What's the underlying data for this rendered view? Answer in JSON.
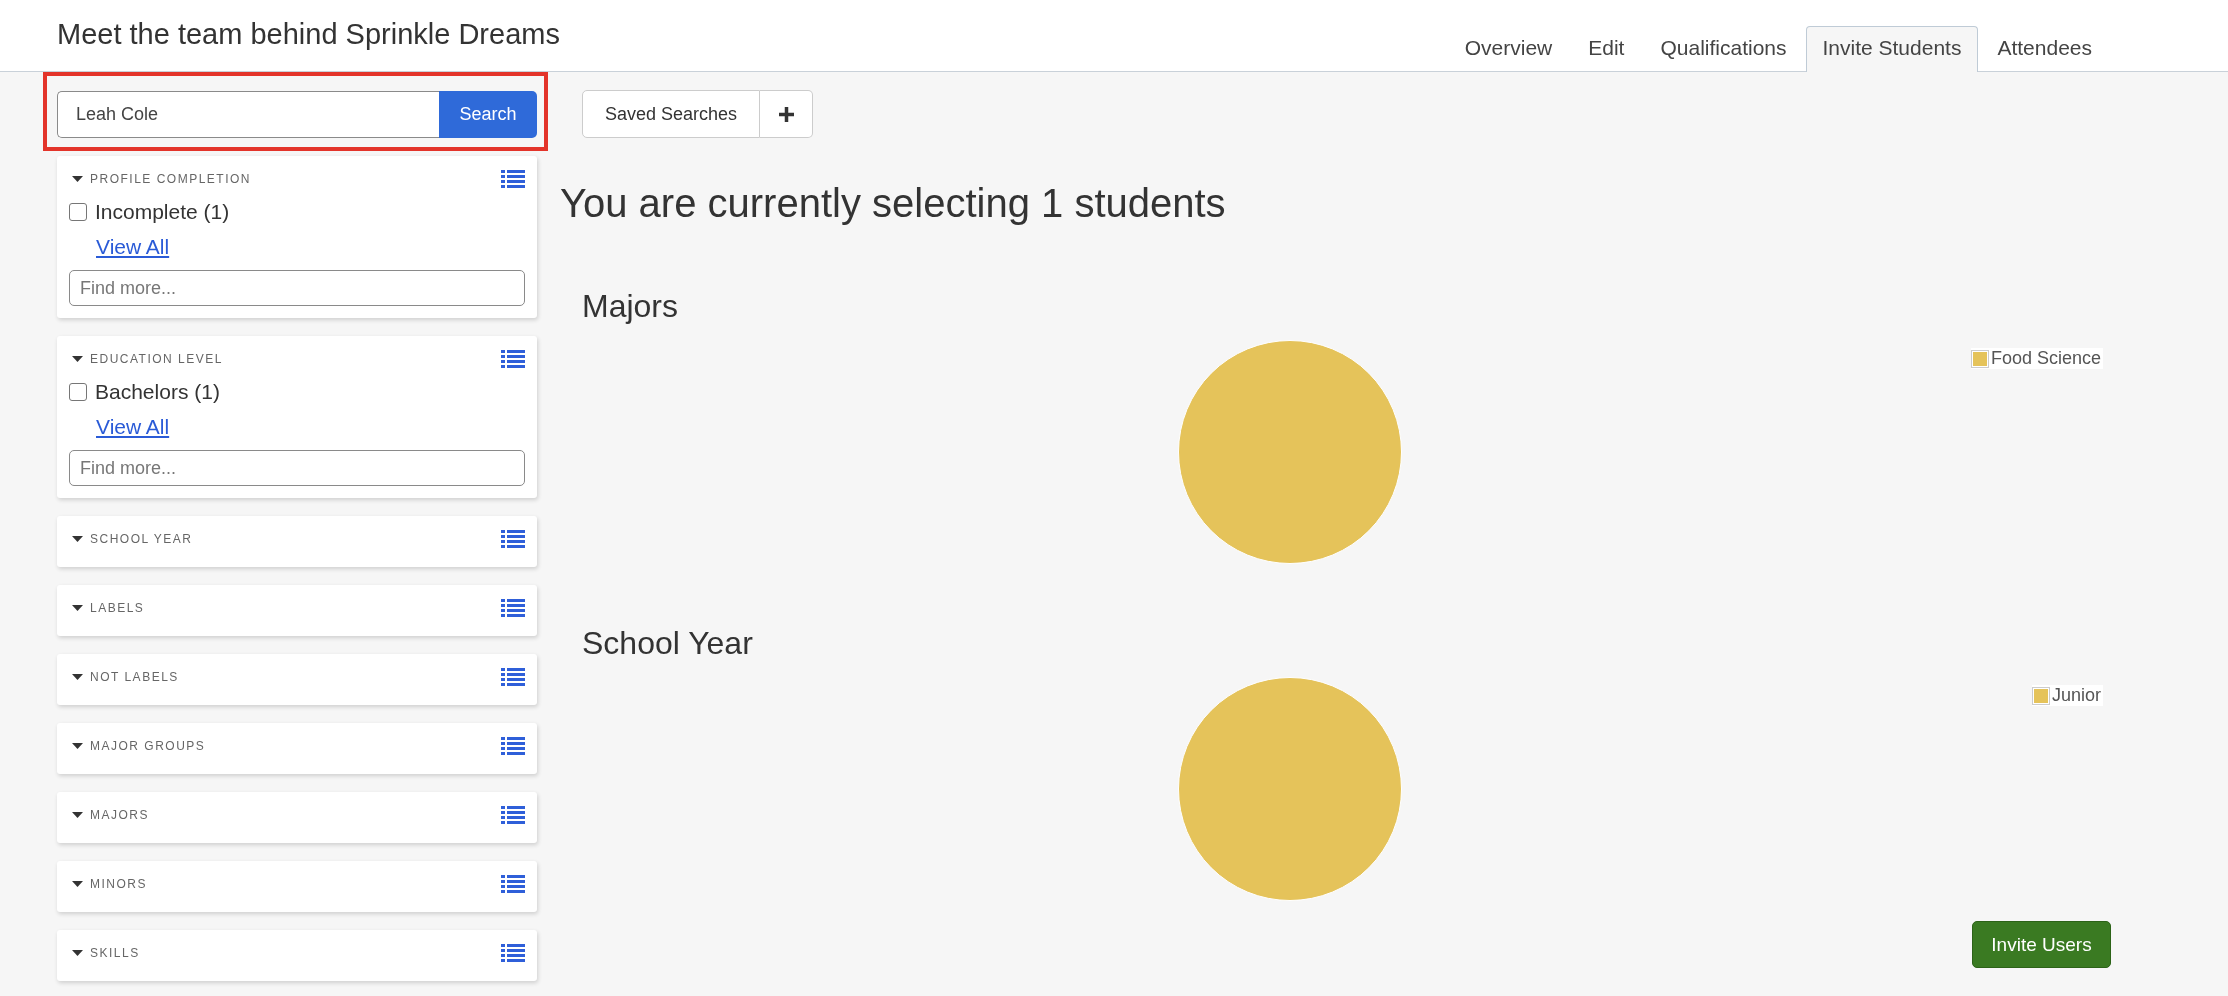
{
  "header": {
    "title": "Meet the team behind Sprinkle Dreams"
  },
  "tabs": [
    {
      "label": "Overview",
      "selected": false
    },
    {
      "label": "Edit",
      "selected": false
    },
    {
      "label": "Qualifications",
      "selected": false
    },
    {
      "label": "Invite Students",
      "selected": true
    },
    {
      "label": "Attendees",
      "selected": false
    }
  ],
  "search": {
    "value": "Leah Cole",
    "button": "Search",
    "highlighted": true
  },
  "filters": [
    {
      "title": "PROFILE COMPLETION",
      "options": [
        {
          "label": "Incomplete (1)",
          "checked": false
        }
      ],
      "link": "View All",
      "placeholder": "Find more..."
    },
    {
      "title": "EDUCATION LEVEL",
      "options": [
        {
          "label": "Bachelors (1)",
          "checked": false
        }
      ],
      "link": "View All",
      "placeholder": "Find more..."
    },
    {
      "title": "SCHOOL YEAR"
    },
    {
      "title": "LABELS"
    },
    {
      "title": "NOT LABELS"
    },
    {
      "title": "MAJOR GROUPS"
    },
    {
      "title": "MAJORS"
    },
    {
      "title": "MINORS"
    },
    {
      "title": "SKILLS"
    }
  ],
  "saved_searches": {
    "label": "Saved Searches"
  },
  "summary": "You are currently selecting 1 students",
  "charts": [
    {
      "title": "Majors",
      "legend": [
        {
          "label": "Food Science",
          "color": "#e5c35a"
        }
      ]
    },
    {
      "title": "School Year",
      "legend": [
        {
          "label": "Junior",
          "color": "#e5c35a"
        }
      ]
    }
  ],
  "invite_button": "Invite Users"
}
